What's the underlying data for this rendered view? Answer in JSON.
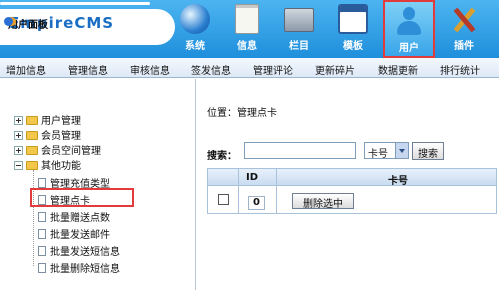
{
  "header": {
    "logo": "EmpireCMS",
    "nav": [
      {
        "label": "系统",
        "icon": "globe-icon"
      },
      {
        "label": "信息",
        "icon": "document-icon"
      },
      {
        "label": "栏目",
        "icon": "folder-icon"
      },
      {
        "label": "模板",
        "icon": "window-icon"
      },
      {
        "label": "用户",
        "icon": "user-icon",
        "active": true
      },
      {
        "label": "插件",
        "icon": "tools-icon"
      }
    ],
    "active_color": "#e23b3b"
  },
  "subnav": [
    "增加信息",
    "管理信息",
    "审核信息",
    "签发信息",
    "管理评论",
    "更新碎片",
    "数据更新",
    "排行统计"
  ],
  "sidebar": {
    "title": "用户面板",
    "groups": [
      "用户管理",
      "会员管理",
      "会员空间管理",
      "其他功能"
    ],
    "items": [
      "管理充值类型",
      "管理点卡",
      "批量赠送点数",
      "批量发送邮件",
      "批量发送短信息",
      "批量删除短信息"
    ],
    "selected_index": 1
  },
  "main": {
    "location_label": "位置：",
    "location_value": "管理点卡",
    "search_label": "搜索：",
    "search_value": "",
    "field_selected": "卡号",
    "search_button": "搜索",
    "table": {
      "headers": [
        "",
        "ID",
        "卡号"
      ],
      "select_all_id": "0",
      "delete_button": "删除选中"
    }
  }
}
